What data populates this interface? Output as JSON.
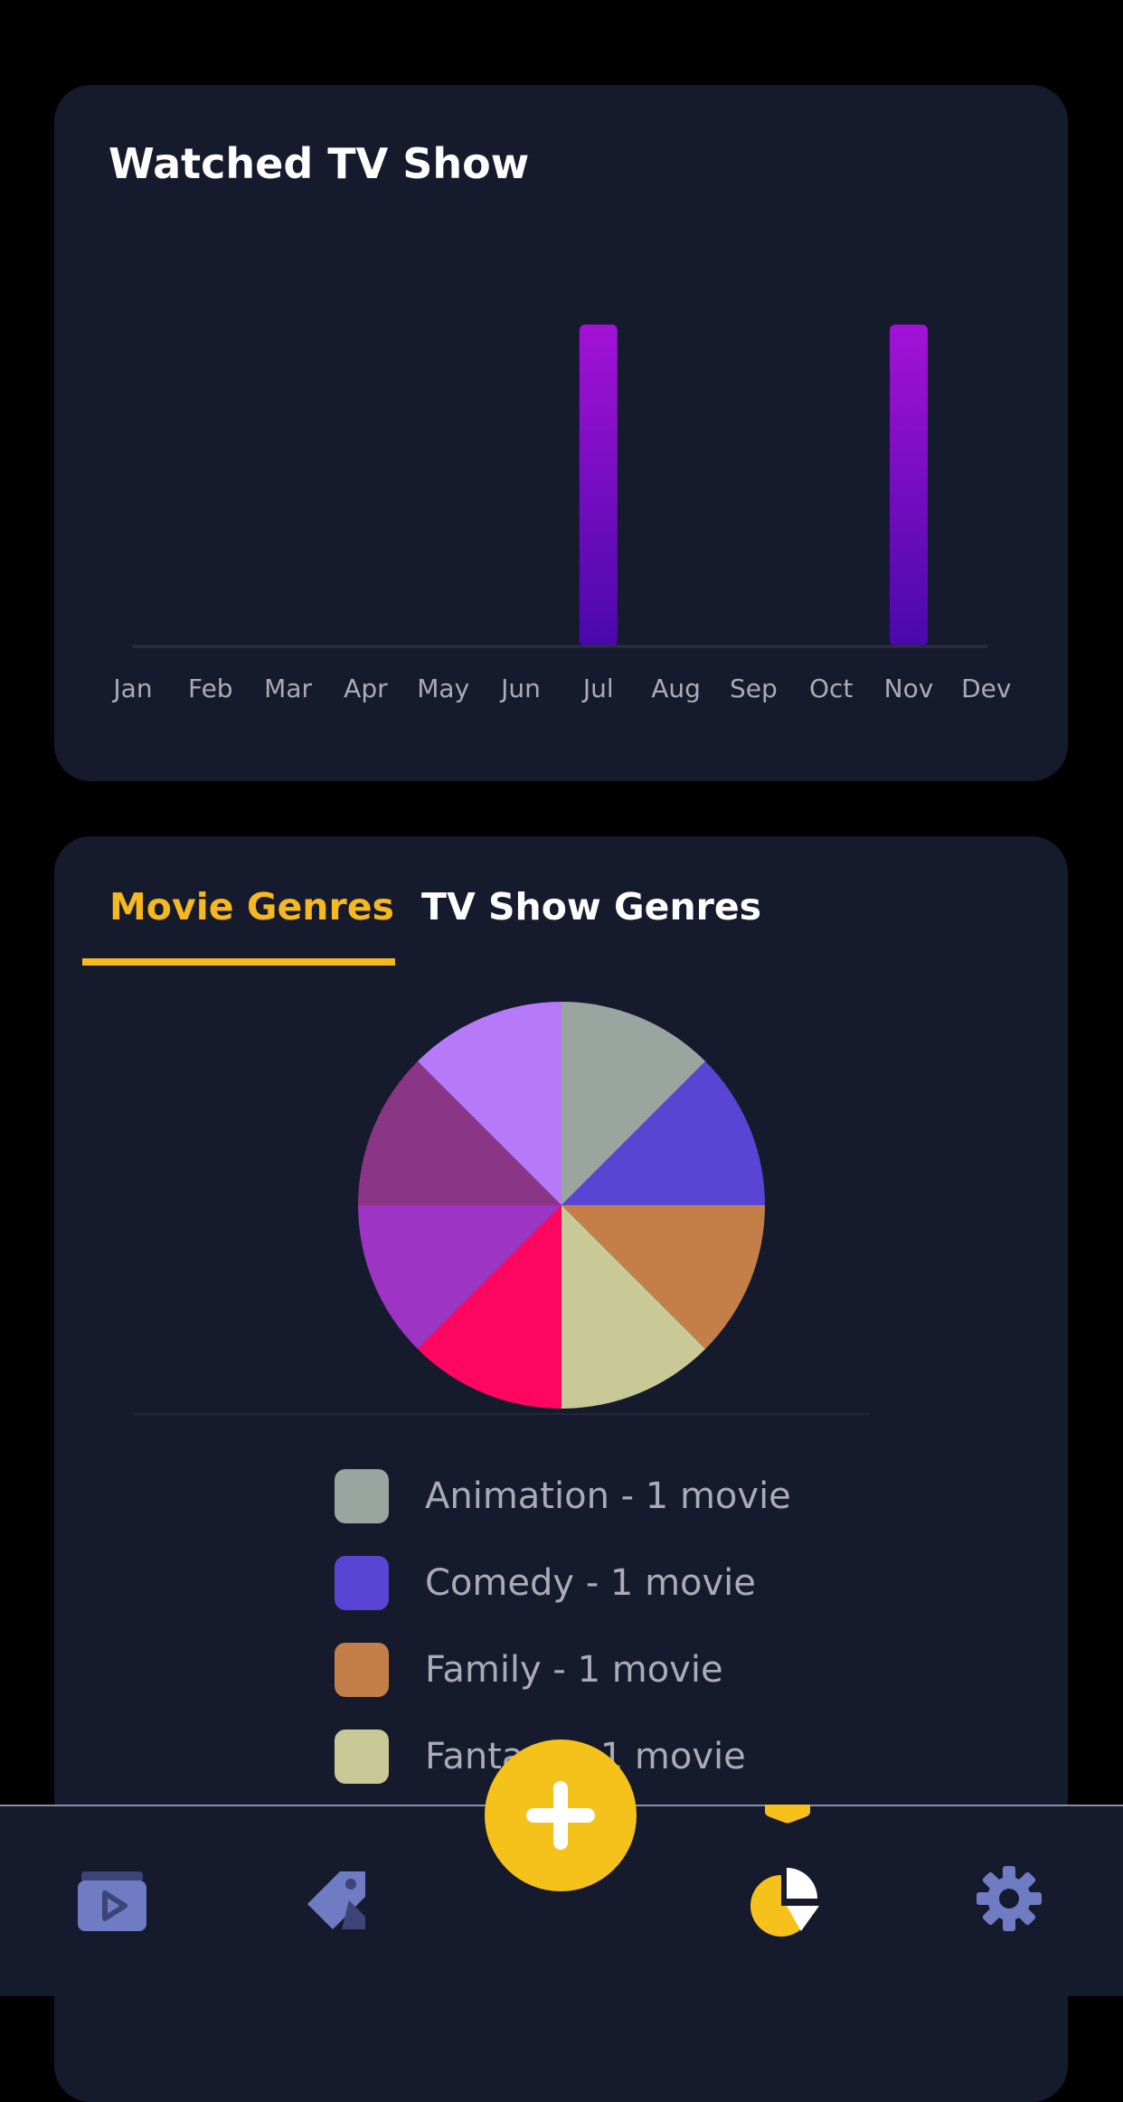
{
  "tv_chart": {
    "title": "Watched TV Show",
    "chart_data": {
      "type": "bar",
      "title": "Watched TV Show",
      "categories": [
        "Jan",
        "Feb",
        "Mar",
        "Apr",
        "May",
        "Jun",
        "Jul",
        "Aug",
        "Sep",
        "Oct",
        "Nov",
        "Dev"
      ],
      "values": [
        0,
        0,
        0,
        0,
        0,
        0,
        1,
        0,
        0,
        0,
        1,
        0
      ],
      "ylim": [
        0,
        1
      ],
      "grid": false,
      "bar_gradient": [
        "#a212d6",
        "#4a08ad"
      ],
      "axis_color": "#2b2f40",
      "tick_color": "#a9abb5"
    }
  },
  "genres": {
    "tabs": [
      {
        "label": "Movie Genres",
        "active": true
      },
      {
        "label": "TV Show Genres",
        "active": false
      }
    ],
    "chart_data": {
      "type": "pie",
      "slices": [
        {
          "label": "Animation",
          "value": 1,
          "color": "#9ba59f"
        },
        {
          "label": "Comedy",
          "value": 1,
          "color": "#5945d3"
        },
        {
          "label": "Family",
          "value": 1,
          "color": "#c47f48"
        },
        {
          "label": "Fantasy",
          "value": 1,
          "color": "#c8c996"
        },
        {
          "label": "",
          "value": 1,
          "color": "#ff0761"
        },
        {
          "label": "",
          "value": 1,
          "color": "#9e34c3"
        },
        {
          "label": "",
          "value": 1,
          "color": "#8a3585"
        },
        {
          "label": "",
          "value": 1,
          "color": "#b679f8"
        }
      ]
    },
    "legend": [
      {
        "label": "Animation - 1 movie",
        "color": "#9ba59f"
      },
      {
        "label": "Comedy - 1 movie",
        "color": "#5945d3"
      },
      {
        "label": "Family - 1 movie",
        "color": "#c47f48"
      },
      {
        "label": "Fantasy - 1 movie",
        "color": "#c8c996"
      }
    ]
  },
  "nav": {
    "items": [
      {
        "icon": "video-player-icon",
        "active": false
      },
      {
        "icon": "tag-icon",
        "active": false
      },
      {
        "icon": "pie-chart-icon",
        "active": true
      },
      {
        "icon": "gear-icon",
        "active": false
      }
    ],
    "fab_icon": "plus-icon",
    "accent": "#f5c21b",
    "inactive_icon_color": "#6f7cc4"
  }
}
